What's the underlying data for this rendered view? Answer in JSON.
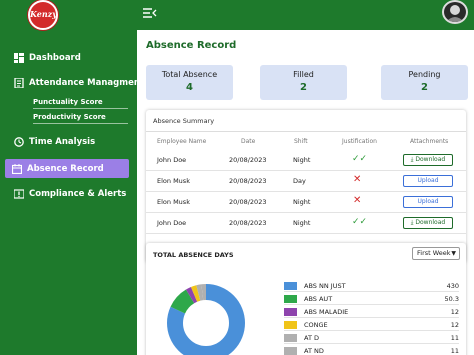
{
  "brand": {
    "logo_text": "Kenzy's"
  },
  "sidebar": {
    "items": [
      {
        "label": "Dashboard",
        "icon": "dashboard-icon"
      },
      {
        "label": "Attendance Managment",
        "icon": "attendance-icon"
      },
      {
        "label": "Time Analysis",
        "icon": "clock-icon"
      },
      {
        "label": "Absence Record",
        "icon": "absence-icon"
      },
      {
        "label": "Compliance & Alerts",
        "icon": "alert-icon"
      }
    ],
    "sub_items": [
      {
        "label": "Punctuality Score"
      },
      {
        "label": "Productivity Score"
      }
    ]
  },
  "page": {
    "title": "Absence Record"
  },
  "stats": [
    {
      "label": "Total Absence",
      "value": "4"
    },
    {
      "label": "Filled",
      "value": "2"
    },
    {
      "label": "Pending",
      "value": "2"
    }
  ],
  "summary": {
    "title": "Absence Summary",
    "headers": [
      "Employee Name",
      "Date",
      "Shift",
      "Justification",
      "Attachments"
    ],
    "rows": [
      {
        "name": "John Doe",
        "date": "20/08/2023",
        "shift": "Night",
        "justified": true,
        "attachment": "Download"
      },
      {
        "name": "Elon Musk",
        "date": "20/08/2023",
        "shift": "Day",
        "justified": false,
        "attachment": "Upload"
      },
      {
        "name": "Elon Musk",
        "date": "20/08/2023",
        "shift": "Night",
        "justified": false,
        "attachment": "Upload"
      },
      {
        "name": "John Doe",
        "date": "20/08/2023",
        "shift": "Night",
        "justified": true,
        "attachment": "Download"
      }
    ]
  },
  "absence_days": {
    "title": "TOTAL ABSENCE DAYS",
    "filter": "First Week",
    "legend": [
      {
        "label": "ABS NN JUST",
        "value": "430",
        "color": "#4a90d9"
      },
      {
        "label": "ABS AUT",
        "value": "50.3",
        "color": "#2ea84a"
      },
      {
        "label": "ABS MALADIE",
        "value": "12",
        "color": "#8e44ad"
      },
      {
        "label": "CONGE",
        "value": "12",
        "color": "#f0c419"
      },
      {
        "label": "AT D",
        "value": "11",
        "color": "#b0b0b0"
      },
      {
        "label": "AT ND",
        "value": "11",
        "color": "#b0b0b0"
      }
    ]
  },
  "colors": {
    "primary": "#1e7a2c",
    "active": "#9b7fe6",
    "card": "#d9e2f5"
  }
}
